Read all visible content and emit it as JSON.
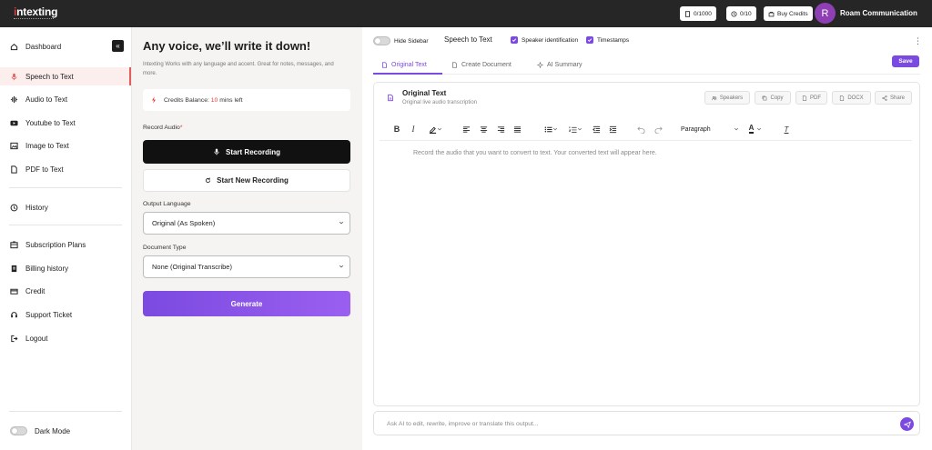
{
  "brand": {
    "logo_text_a": "i",
    "logo_text_b": "ntexting"
  },
  "header": {
    "credits_counter": "0/1000",
    "timer_counter": "0/10",
    "buy_credits": "Buy Credits",
    "avatar_initial": "R",
    "username": "Roam Communication"
  },
  "sidebar": {
    "items": [
      {
        "label": "Dashboard",
        "icon": "home-icon"
      },
      {
        "label": "Speech to Text",
        "icon": "mic-icon",
        "active": true
      },
      {
        "label": "Audio to Text",
        "icon": "waveform-icon"
      },
      {
        "label": "Youtube to Text",
        "icon": "youtube-icon"
      },
      {
        "label": "Image to Text",
        "icon": "image-icon"
      },
      {
        "label": "PDF to Text",
        "icon": "file-icon"
      },
      {
        "label": "History",
        "icon": "history-icon"
      },
      {
        "label": "Subscription Plans",
        "icon": "plans-icon"
      },
      {
        "label": "Billing history",
        "icon": "billing-icon"
      },
      {
        "label": "Credit",
        "icon": "credit-card-icon"
      },
      {
        "label": "Support Ticket",
        "icon": "support-icon"
      },
      {
        "label": "Logout",
        "icon": "logout-icon"
      }
    ],
    "dark_mode_label": "Dark Mode",
    "collapse_glyph": "«"
  },
  "panel": {
    "title": "Any voice, we’ll write it down!",
    "description": "Intexting Works with any language and accent. Great for notes, messages, and more.",
    "credits_label": "Credits Balance:",
    "credits_value": "10",
    "credits_unit": "mins left",
    "record_audio_label": "Record Audio",
    "required_mark": "*",
    "start_recording": "Start Recording",
    "start_new_recording": "Start New Recording",
    "output_language_label": "Output Language",
    "output_language_value": "Original (As Spoken)",
    "document_type_label": "Document Type",
    "document_type_value": "None (Original Transcribe)",
    "generate": "Generate"
  },
  "workspace": {
    "hide_sidebar": "Hide Sidebar",
    "mode_title": "Speech to Text",
    "speaker_identification": "Speaker identification",
    "timestamps": "Timestamps",
    "tabs": [
      {
        "label": "Original Text",
        "active": true
      },
      {
        "label": "Create Document"
      },
      {
        "label": "AI Summary"
      }
    ],
    "save": "Save",
    "kebab": "⋮"
  },
  "editor": {
    "title": "Original Text",
    "subtitle": "Original live audio transcription",
    "actions": [
      "Speakers",
      "Copy",
      "PDF",
      "DOCX",
      "Share"
    ],
    "toolbar": {
      "bold": "B",
      "italic": "I",
      "block_format": "Paragraph",
      "text_color_glyph": "A",
      "clear_format_glyph": "T"
    },
    "placeholder": "Record the audio that you want to convert to text. Your converted text will appear here."
  },
  "ai_bar": {
    "placeholder": "Ask AI to edit, rewrite, improve or translate this output..."
  },
  "colors": {
    "accent": "#7b4ae0",
    "topbar": "#262626",
    "danger": "#e53935",
    "active_nav_bg": "#fdeeee"
  }
}
